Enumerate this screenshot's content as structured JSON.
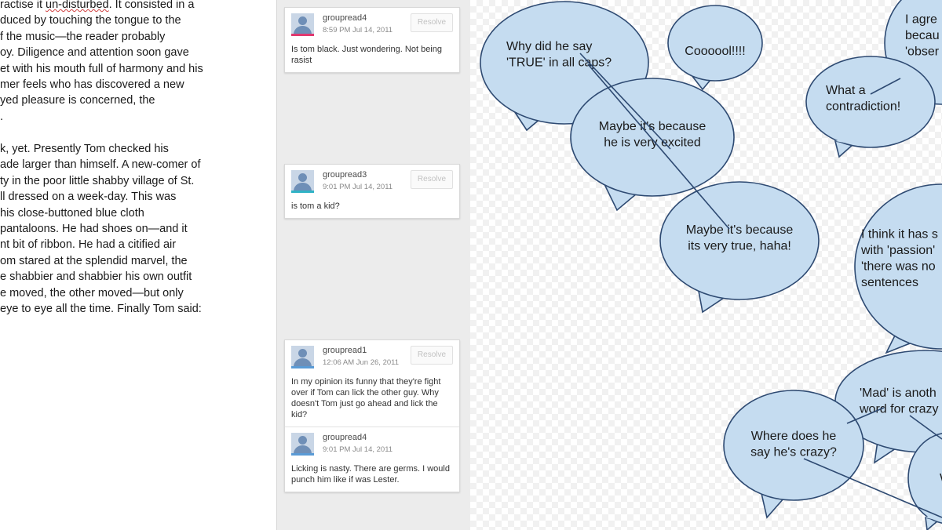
{
  "document": {
    "paragraphs": [
      [
        {
          "text": "ractise it ",
          "u": "un-disturbed",
          "after": ". It consisted in a"
        },
        {
          "text": "duced by touching the tongue to the"
        },
        {
          "text": "f the music—the reader probably"
        },
        {
          "text": "oy. Diligence and attention soon gave"
        },
        {
          "text": "et with his mouth full of harmony and his"
        },
        {
          "text": "mer feels who has discovered a new"
        },
        {
          "text": "yed pleasure is concerned, the"
        },
        {
          "text": "."
        }
      ],
      [
        {
          "text": "k, yet. Presently Tom checked his"
        },
        {
          "text": "ade larger than himself. A new-comer of"
        },
        {
          "text": "ty in the poor little shabby village of St."
        },
        {
          "text": "ll dressed on a week-day. This was"
        },
        {
          "text": "his close-buttoned blue cloth"
        },
        {
          "text": "pantaloons. He had shoes on—and it"
        },
        {
          "text": "nt bit of ribbon. He had a citified air"
        },
        {
          "text": "om stared at the splendid marvel, the"
        },
        {
          "text": "e shabbier and shabbier his own outfit"
        },
        {
          "text": "e moved, the other moved—but only"
        },
        {
          "text": "eye to eye all the time. Finally Tom said:"
        }
      ]
    ]
  },
  "comments": {
    "resolve_label": "Resolve",
    "cards": [
      {
        "entries": [
          {
            "author": "groupread4",
            "time": "8:59 PM Jul 14, 2011",
            "text": "Is tom black. Just wondering. Not being rasist",
            "accent": "#e0386f",
            "resolve": true
          }
        ]
      },
      {
        "entries": [
          {
            "author": "groupread3",
            "time": "9:01 PM Jul 14, 2011",
            "text": "is tom a kid?",
            "accent": "#2fb3c6",
            "resolve": true
          }
        ]
      },
      {
        "entries": [
          {
            "author": "groupread1",
            "time": "12:06 AM Jun 26, 2011",
            "text": "In my opinion its funny that they're fight over if Tom can lick the other guy. Why doesn't Tom just go ahead and lick the kid?",
            "accent": "#5a9bd6",
            "resolve": true
          },
          {
            "author": "groupread4",
            "time": "9:01 PM Jul 14, 2011",
            "text": "Licking is nasty. There are germs. I would punch him like if was Lester.",
            "accent": "#5a9bd6",
            "resolve": false
          }
        ]
      }
    ]
  },
  "bubbles": {
    "fill": "#c5dcf0",
    "stroke": "#2e4a72",
    "items": [
      {
        "id": "why-true",
        "lines": [
          "Why did he say",
          "'TRUE' in all caps?"
        ]
      },
      {
        "id": "cooool",
        "lines": [
          "Coooool!!!!"
        ]
      },
      {
        "id": "i-agree",
        "lines": [
          "I agre",
          "becau",
          "'obser"
        ]
      },
      {
        "id": "contradiction",
        "lines": [
          "What a",
          "contradiction!"
        ]
      },
      {
        "id": "excited",
        "lines": [
          "Maybe it's because",
          "he is very excited"
        ]
      },
      {
        "id": "very-true",
        "lines": [
          "Maybe it's because",
          "its very true, haha!"
        ]
      },
      {
        "id": "passion",
        "lines": [
          "I think it has s",
          "with 'passion'",
          "'there was no",
          "sentences"
        ]
      },
      {
        "id": "mad",
        "lines": [
          "'Mad' is anoth",
          "word for crazy"
        ]
      },
      {
        "id": "crazy",
        "lines": [
          "Where does he",
          "say he's crazy?"
        ]
      },
      {
        "id": "w-partial",
        "lines": [
          "W"
        ]
      }
    ]
  }
}
